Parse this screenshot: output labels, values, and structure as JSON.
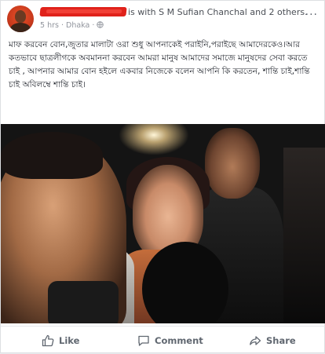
{
  "post": {
    "with_text": "is with S M Sufian Chanchal and 2 others.",
    "time": "5 hrs",
    "location": "Dhaka",
    "separator": "·",
    "more": "...",
    "body": "মাফ করবেন বোন,জুতার মালাটা ওরা শুধু আপনাকেই পরাইনি,পরাইছে আমাদেরকেও।আর কতভাবে ছাত্রলীগকে অবমাননা করবেন আমরা মানুষ আমাদের সমাজে মানুষদের সেবা করতে চাই , আপনার আমার বোন হইলে একবার নিজেকে বলেন আপনি কি করতেন, শান্তি চাই,শান্তি চাই অবিলম্বে শান্তি চাই।"
  },
  "actions": {
    "like": "Like",
    "comment": "Comment",
    "share": "Share"
  },
  "icons": {
    "globe": "globe-icon",
    "like": "thumbs-up-icon",
    "comment": "comment-icon",
    "share": "share-icon",
    "more": "more-icon"
  }
}
